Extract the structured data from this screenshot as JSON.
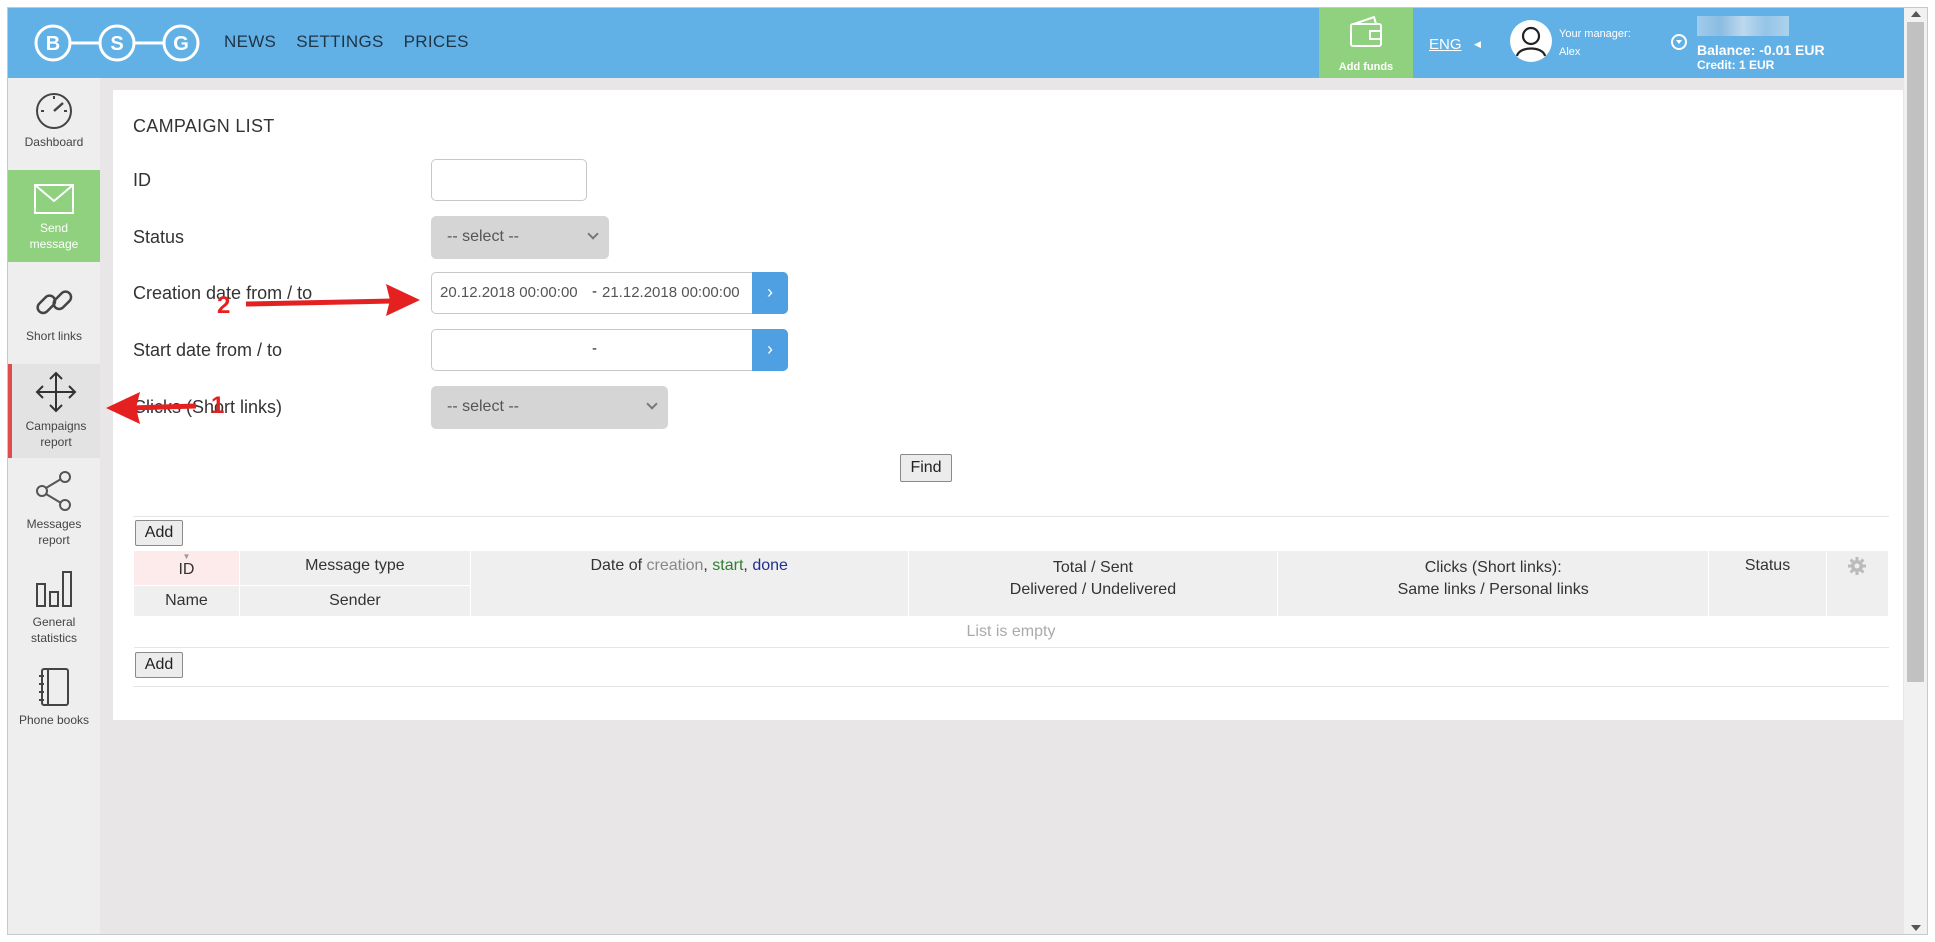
{
  "logo": {
    "letters": [
      "B",
      "S",
      "G"
    ]
  },
  "nav": {
    "items": [
      "NEWS",
      "SETTINGS",
      "PRICES"
    ]
  },
  "header": {
    "add_funds": "Add funds",
    "language": "ENG",
    "manager_label": "Your manager:",
    "manager_name": "Alex",
    "balance": "Balance: -0.01 EUR",
    "credit": "Credit: 1 EUR"
  },
  "sidebar": {
    "items": [
      {
        "label": "Dashboard",
        "icon": "gauge-icon"
      },
      {
        "label": "Send message",
        "icon": "envelope-icon"
      },
      {
        "label": "Short links",
        "icon": "link-icon"
      },
      {
        "label": "Campaigns report",
        "icon": "move-arrows-icon"
      },
      {
        "label": "Messages report",
        "icon": "share-icon"
      },
      {
        "label": "General statistics",
        "icon": "bar-chart-icon"
      },
      {
        "label": "Phone books",
        "icon": "notebook-icon"
      }
    ]
  },
  "page": {
    "title": "CAMPAIGN LIST"
  },
  "filters": {
    "id_label": "ID",
    "id_value": "",
    "status_label": "Status",
    "status_value": "-- select --",
    "creation_label": "Creation date from / to",
    "creation_from": "20.12.2018 00:00:00",
    "creation_sep": "-",
    "creation_to": "21.12.2018 00:00:00",
    "start_label": "Start date from / to",
    "start_sep": "-",
    "clicks_label": "Clicks (Short links)",
    "clicks_value": "-- select --",
    "find": "Find"
  },
  "table": {
    "add": "Add",
    "col_id": "ID",
    "col_name": "Name",
    "col_message_type": "Message type",
    "col_sender": "Sender",
    "col_date_prefix": "Date of ",
    "col_date_creation": "creation",
    "col_date_comma1": ", ",
    "col_date_start": "start",
    "col_date_comma2": ", ",
    "col_date_done": "done",
    "col_total_line1": "Total / Sent",
    "col_total_line2": "Delivered / Undelivered",
    "col_clicks_line1": "Clicks (Short links):",
    "col_clicks_line2": "Same links / Personal links",
    "col_status": "Status",
    "empty": "List is empty"
  },
  "annotations": {
    "one": "1",
    "two": "2"
  },
  "colors": {
    "header": "#62b1e6",
    "green": "#8fd17f",
    "accent_blue": "#4ea0e3",
    "arrow": "#e52020"
  }
}
